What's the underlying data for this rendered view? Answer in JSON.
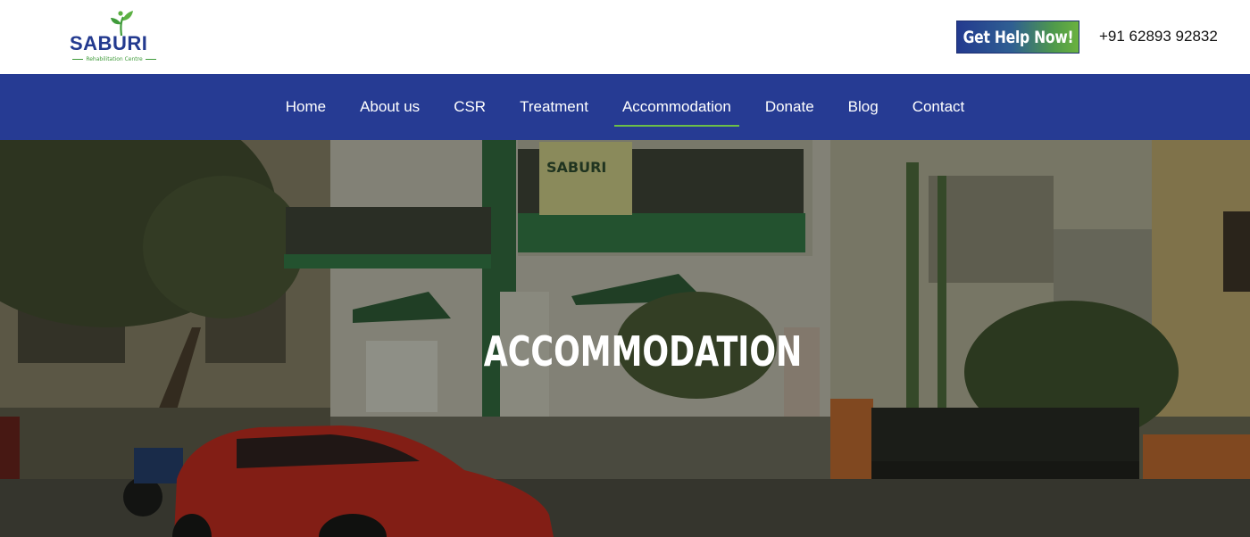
{
  "header": {
    "logo": {
      "name": "SABURI",
      "tagline": "Rehabilitation Centre"
    },
    "cta_label": "Get Help Now!",
    "phone": "+91 62893 92832"
  },
  "nav": {
    "items": [
      {
        "label": "Home"
      },
      {
        "label": "About us"
      },
      {
        "label": "CSR"
      },
      {
        "label": "Treatment"
      },
      {
        "label": "Accommodation",
        "active": true
      },
      {
        "label": "Donate"
      },
      {
        "label": "Blog"
      },
      {
        "label": "Contact"
      }
    ]
  },
  "hero": {
    "title": "ACCOMMODATION",
    "signboard": "SABURI"
  },
  "colors": {
    "brand_blue": "#263b93",
    "brand_green": "#6cbf47",
    "text_dark": "#111111"
  },
  "icons": [
    "leaf-icon"
  ]
}
